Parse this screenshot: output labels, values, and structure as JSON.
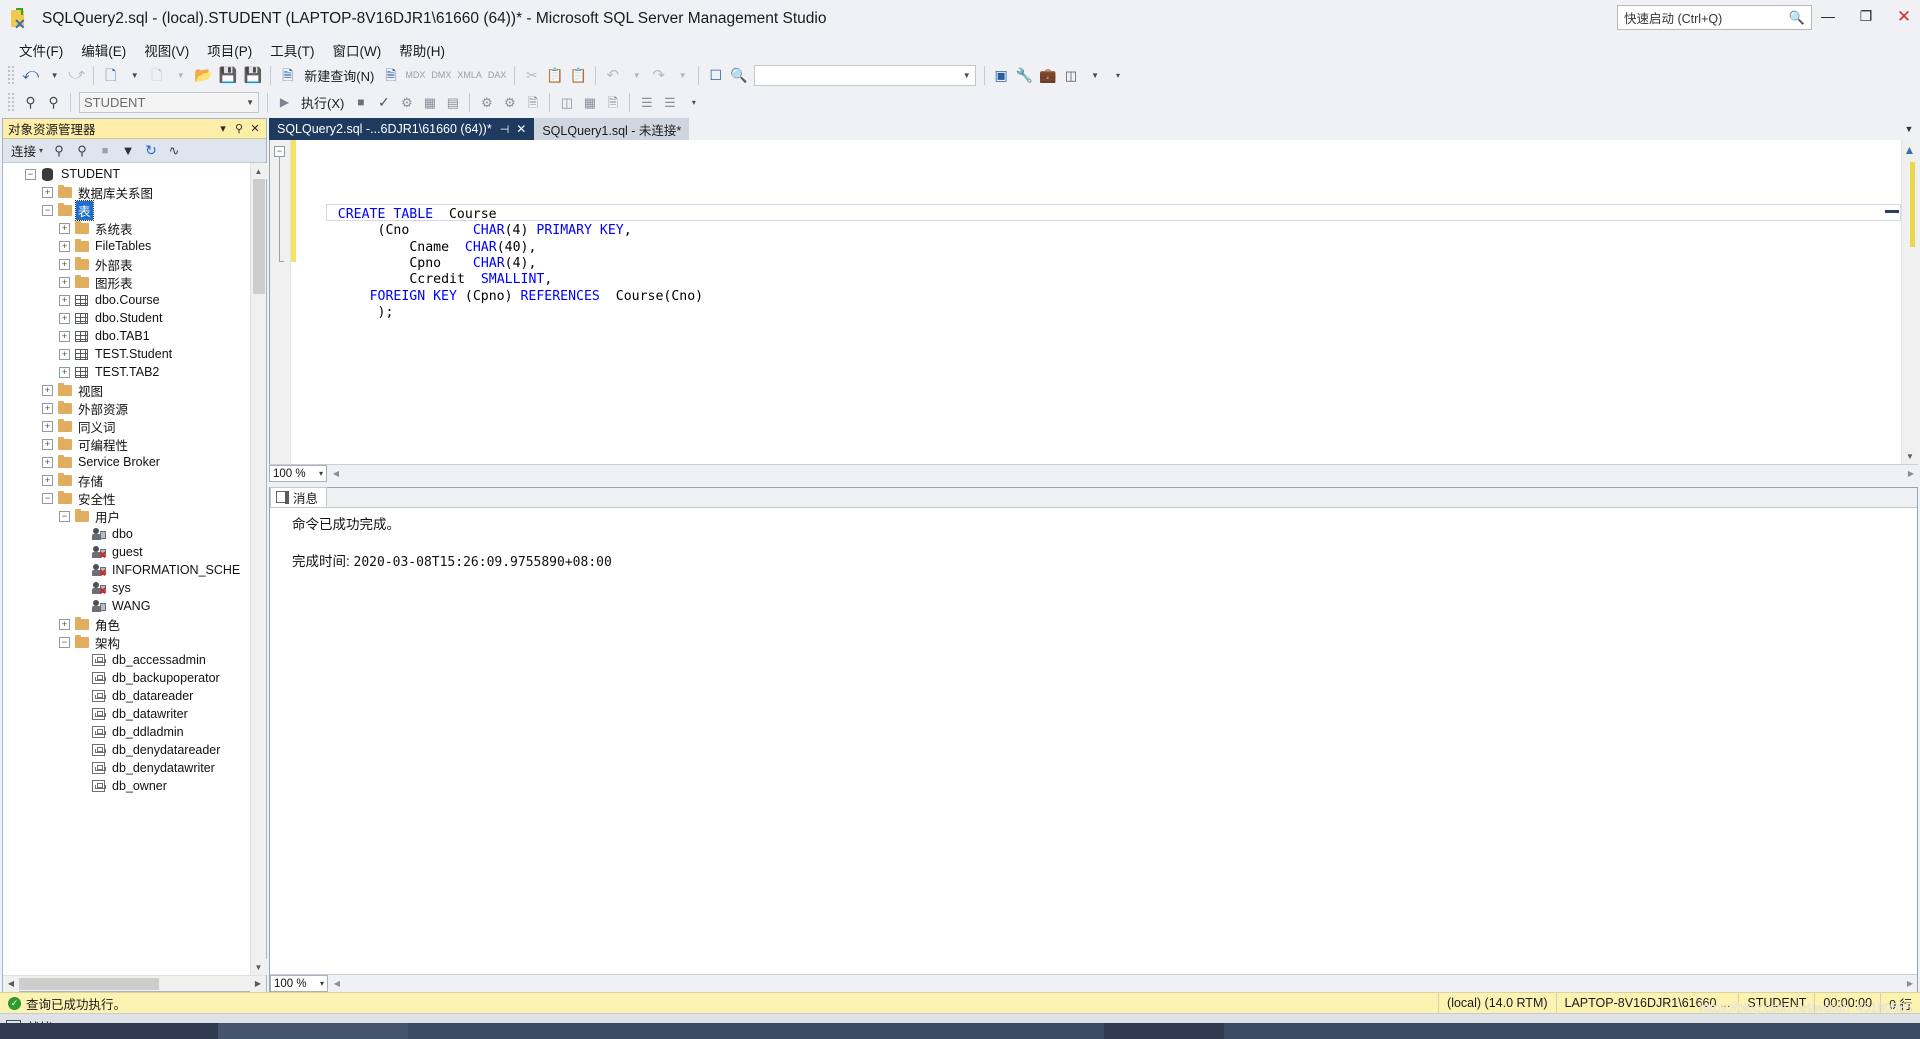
{
  "window": {
    "title": "SQLQuery2.sql - (local).STUDENT (LAPTOP-8V16DJR1\\61660 (64))* - Microsoft SQL Server Management Studio",
    "app_icon": "ssms-icon",
    "quick_launch_placeholder": "快速启动 (Ctrl+Q)",
    "minimize": "—",
    "restore": "❐",
    "close": "✕"
  },
  "menu": {
    "items": [
      {
        "label": "文件(F)"
      },
      {
        "label": "编辑(E)"
      },
      {
        "label": "视图(V)"
      },
      {
        "label": "项目(P)"
      },
      {
        "label": "工具(T)"
      },
      {
        "label": "窗口(W)"
      },
      {
        "label": "帮助(H)"
      }
    ]
  },
  "toolbar_main": {
    "nav_back": "◀",
    "nav_forward": "▶",
    "new_project": "new-project",
    "add_item": "add-item",
    "open_file": "open-file",
    "save": "save",
    "save_all": "save-all",
    "new_query_label": "新建查询(N)",
    "new_query_db": "db-query",
    "mdx": "MDX",
    "dmx": "DMX",
    "xmla": "XMLA",
    "dax": "DAX",
    "cut": "✂",
    "copy": "copy",
    "paste": "paste",
    "undo": "↶",
    "redo": "↷",
    "extra": "tool"
  },
  "toolbar_query": {
    "connect": "connect",
    "disconnect": "disconnect",
    "database_value": "STUDENT",
    "execute_label": "执行(X)",
    "stop": "■",
    "parse": "✓",
    "display_plan": "display-plan",
    "results_grid": "results-to-grid",
    "results_text": "results-to-text",
    "include_plan": "include-plan",
    "live_stats": "live-stats",
    "results_file": "results-to-file",
    "comment": "comment",
    "uncomment": "uncomment",
    "indent": "indent",
    "options": "options"
  },
  "object_explorer": {
    "title": "对象资源管理器",
    "title_buttons": {
      "dropdown": "▾",
      "pin": "⚲",
      "close": "✕"
    },
    "toolbar": {
      "connect_label": "连接",
      "connect_caret": "▾",
      "connect_icon": "connect-icon",
      "disconnect_icon": "disconnect-icon",
      "stop_icon": "stop-icon",
      "filter_icon": "filter-icon",
      "refresh_icon": "refresh-icon",
      "activity_icon": "activity-monitor-icon"
    },
    "tree": [
      {
        "label": "STUDENT",
        "indent": 0,
        "expander": "−",
        "icon": "database",
        "selected": false
      },
      {
        "label": "数据库关系图",
        "indent": 1,
        "expander": "+",
        "icon": "folder",
        "selected": false
      },
      {
        "label": "表",
        "indent": 1,
        "expander": "−",
        "icon": "folder",
        "selected": true
      },
      {
        "label": "系统表",
        "indent": 2,
        "expander": "+",
        "icon": "folder",
        "selected": false
      },
      {
        "label": "FileTables",
        "indent": 2,
        "expander": "+",
        "icon": "folder",
        "selected": false
      },
      {
        "label": "外部表",
        "indent": 2,
        "expander": "+",
        "icon": "folder",
        "selected": false
      },
      {
        "label": "图形表",
        "indent": 2,
        "expander": "+",
        "icon": "folder",
        "selected": false
      },
      {
        "label": "dbo.Course",
        "indent": 2,
        "expander": "+",
        "icon": "table",
        "selected": false
      },
      {
        "label": "dbo.Student",
        "indent": 2,
        "expander": "+",
        "icon": "table",
        "selected": false
      },
      {
        "label": "dbo.TAB1",
        "indent": 2,
        "expander": "+",
        "icon": "table",
        "selected": false
      },
      {
        "label": "TEST.Student",
        "indent": 2,
        "expander": "+",
        "icon": "table",
        "selected": false
      },
      {
        "label": "TEST.TAB2",
        "indent": 2,
        "expander": "+",
        "icon": "table",
        "selected": false
      },
      {
        "label": "视图",
        "indent": 1,
        "expander": "+",
        "icon": "folder",
        "selected": false
      },
      {
        "label": "外部资源",
        "indent": 1,
        "expander": "+",
        "icon": "folder",
        "selected": false
      },
      {
        "label": "同义词",
        "indent": 1,
        "expander": "+",
        "icon": "folder",
        "selected": false
      },
      {
        "label": "可编程性",
        "indent": 1,
        "expander": "+",
        "icon": "folder",
        "selected": false
      },
      {
        "label": "Service Broker",
        "indent": 1,
        "expander": "+",
        "icon": "folder",
        "selected": false
      },
      {
        "label": "存储",
        "indent": 1,
        "expander": "+",
        "icon": "folder",
        "selected": false
      },
      {
        "label": "安全性",
        "indent": 1,
        "expander": "−",
        "icon": "folder",
        "selected": false
      },
      {
        "label": "用户",
        "indent": 2,
        "expander": "−",
        "icon": "folder",
        "selected": false
      },
      {
        "label": "dbo",
        "indent": 3,
        "expander": "",
        "icon": "user",
        "selected": false
      },
      {
        "label": "guest",
        "indent": 3,
        "expander": "",
        "icon": "user-disabled",
        "selected": false
      },
      {
        "label": "INFORMATION_SCHE",
        "indent": 3,
        "expander": "",
        "icon": "user-disabled",
        "selected": false
      },
      {
        "label": "sys",
        "indent": 3,
        "expander": "",
        "icon": "user-disabled",
        "selected": false
      },
      {
        "label": "WANG",
        "indent": 3,
        "expander": "",
        "icon": "user",
        "selected": false
      },
      {
        "label": "角色",
        "indent": 2,
        "expander": "+",
        "icon": "folder",
        "selected": false
      },
      {
        "label": "架构",
        "indent": 2,
        "expander": "−",
        "icon": "folder",
        "selected": false
      },
      {
        "label": "db_accessadmin",
        "indent": 3,
        "expander": "",
        "icon": "schema",
        "selected": false
      },
      {
        "label": "db_backupoperator",
        "indent": 3,
        "expander": "",
        "icon": "schema",
        "selected": false
      },
      {
        "label": "db_datareader",
        "indent": 3,
        "expander": "",
        "icon": "schema",
        "selected": false
      },
      {
        "label": "db_datawriter",
        "indent": 3,
        "expander": "",
        "icon": "schema",
        "selected": false
      },
      {
        "label": "db_ddladmin",
        "indent": 3,
        "expander": "",
        "icon": "schema",
        "selected": false
      },
      {
        "label": "db_denydatareader",
        "indent": 3,
        "expander": "",
        "icon": "schema",
        "selected": false
      },
      {
        "label": "db_denydatawriter",
        "indent": 3,
        "expander": "",
        "icon": "schema",
        "selected": false
      },
      {
        "label": "db_owner",
        "indent": 3,
        "expander": "",
        "icon": "schema",
        "selected": false
      }
    ]
  },
  "editor": {
    "tabs": [
      {
        "label": "SQLQuery2.sql -...6DJR1\\61660 (64))*",
        "active": true,
        "pin": "⊣",
        "close": "✕"
      },
      {
        "label": "SQLQuery1.sql - 未连接*",
        "active": false,
        "pin": "",
        "close": ""
      }
    ],
    "tab_menu_icon": "chevron-down-icon",
    "zoom_value": "100 %",
    "zoom_caret": "▾",
    "code_lines": [
      {
        "indent": 4,
        "segments": [
          {
            "t": "CREATE TABLE",
            "c": "kw"
          },
          {
            "t": "  Course",
            "c": ""
          }
        ]
      },
      {
        "indent": 9,
        "segments": [
          {
            "t": "(Cno",
            "c": ""
          },
          {
            "t": "        ",
            "c": ""
          },
          {
            "t": "CHAR",
            "c": "kw"
          },
          {
            "t": "(4) ",
            "c": ""
          },
          {
            "t": "PRIMARY KEY",
            "c": "kw"
          },
          {
            "t": ",",
            "c": ""
          }
        ]
      },
      {
        "indent": 13,
        "segments": [
          {
            "t": "Cname  ",
            "c": ""
          },
          {
            "t": "CHAR",
            "c": "kw"
          },
          {
            "t": "(40),",
            "c": ""
          }
        ]
      },
      {
        "indent": 13,
        "segments": [
          {
            "t": "Cpno    ",
            "c": ""
          },
          {
            "t": "CHAR",
            "c": "kw"
          },
          {
            "t": "(4),",
            "c": ""
          }
        ]
      },
      {
        "indent": 13,
        "segments": [
          {
            "t": "Ccredit  ",
            "c": ""
          },
          {
            "t": "SMALLINT",
            "c": "kw"
          },
          {
            "t": ",",
            "c": ""
          }
        ]
      },
      {
        "indent": 8,
        "segments": [
          {
            "t": "FOREIGN KEY",
            "c": "kw"
          },
          {
            "t": " (Cpno) ",
            "c": ""
          },
          {
            "t": "REFERENCES",
            "c": "kw"
          },
          {
            "t": "  Course(Cno)",
            "c": ""
          }
        ]
      },
      {
        "indent": 9,
        "segments": [
          {
            "t": ");",
            "c": ""
          }
        ]
      }
    ]
  },
  "messages": {
    "tab_label": "消息",
    "tab_icon": "messages-icon",
    "line1": "命令已成功完成。",
    "line2_label": "完成时间: ",
    "line2_value": "2020-03-08T15:26:09.9755890+08:00",
    "zoom_value": "100 %",
    "zoom_caret": "▾"
  },
  "statusbar": {
    "status_text": "查询已成功执行。",
    "status_icon": "success-check-icon",
    "server": "(local) (14.0 RTM)",
    "user": "LAPTOP-8V16DJR1\\61660 ...",
    "database": "STUDENT",
    "elapsed": "00:00:00",
    "rows": "0 行"
  },
  "taskbar": {
    "ready_label": "就绪",
    "ready_icon": "window-icon"
  },
  "watermark": "https://blog.csdn.net/weixin_45180685",
  "colors": {
    "accent_blue": "#1f6fd0",
    "tab_active": "#1e3a5f",
    "status_yellow": "#fcf3b3",
    "oe_title_yellow": "#ffeea8",
    "keyword_blue": "#0000ff",
    "folder_gold": "#e0ae5e",
    "success_green": "#2f9a2f"
  }
}
